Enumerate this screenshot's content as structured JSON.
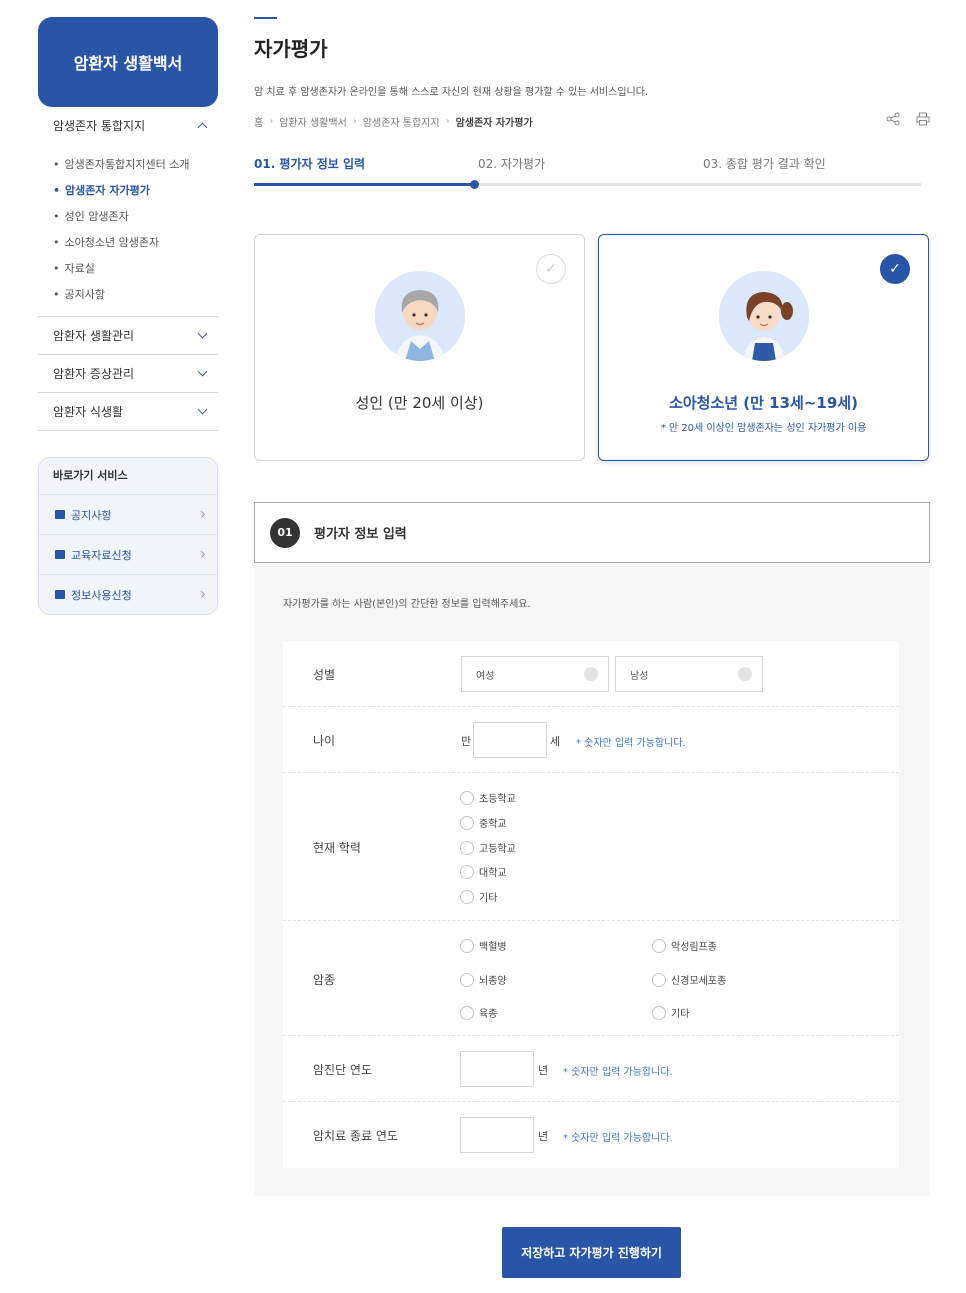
{
  "sidebar": {
    "brand": "암환자 생활백서",
    "open_group": "암생존자 통합지지",
    "submenu": [
      "암생존자통합지지센터 소개",
      "암생존자 자가평가",
      "성인 암생존자",
      "소아청소년 암생존자",
      "자료실",
      "공지사항"
    ],
    "groups": [
      "암환자 생활관리",
      "암환자 증상관리",
      "암환자 식생활"
    ],
    "quick": {
      "title": "바로가기 서비스",
      "items": [
        "공지사항",
        "교육자료신청",
        "정보사용신청"
      ]
    }
  },
  "page": {
    "title": "자가평가",
    "description": "암 치료 후 암생존자가 온라인을 통해 스스로 자신의 현재 상황을 평가할 수 있는 서비스입니다.",
    "breadcrumb": [
      "홈",
      "암환자 생활백서",
      "암생존자 통합지지",
      "암생존자 자가평가"
    ]
  },
  "steps": {
    "labels": [
      "01. 평가자 정보 입력",
      "02. 자가평가",
      "03. 종합 평가 결과 확인"
    ],
    "current": 1,
    "progress": 0.33
  },
  "cards": {
    "adult": {
      "title": "성인 (만 20세 이상)"
    },
    "youth": {
      "title": "소아청소년 (만 13세~19세)",
      "note": "* 만 20세 이상인 암생존자는 성인 자가평가 이용"
    }
  },
  "section": {
    "number": "01",
    "title": "평가자 정보 입력"
  },
  "form": {
    "description": "자가평가를 하는 사람(본인)의 간단한 정보를 입력해주세요.",
    "gender": {
      "label": "성별",
      "options": [
        "여성",
        "남성"
      ]
    },
    "age": {
      "label": "나이",
      "prefix": "만",
      "suffix": "세",
      "hint": "* 숫자만 입력 가능합니다."
    },
    "education": {
      "label": "현재 학력",
      "options": [
        "초등학교",
        "중학교",
        "고등학교",
        "대학교",
        "기타"
      ]
    },
    "cancer": {
      "label": "암종",
      "options": [
        "백혈병",
        "악성림프종",
        "뇌종양",
        "신경모세포종",
        "육종",
        "기타"
      ]
    },
    "diagnosis_year": {
      "label": "암진단 연도",
      "suffix": "년",
      "hint": "* 숫자만 입력 가능합니다."
    },
    "end_year": {
      "label": "암치료 종료 연도",
      "suffix": "년",
      "hint": "* 숫자만 입력 가능합니다."
    }
  },
  "submit_label": "저장하고 자가평가 진행하기"
}
